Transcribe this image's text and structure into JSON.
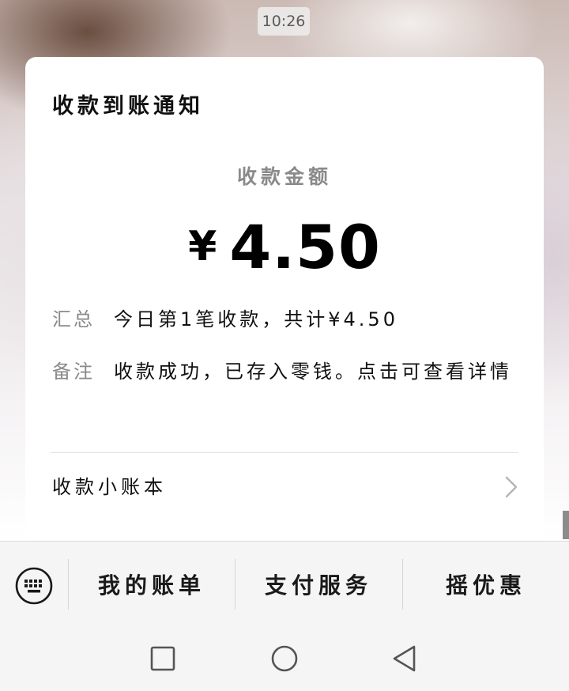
{
  "status": {
    "time": "10:26"
  },
  "card": {
    "title": "收款到账通知",
    "amount_label": "收款金额",
    "currency_symbol": "¥",
    "amount": "4.50",
    "summary": {
      "key": "汇总",
      "value": "今日第1笔收款，共计¥4.50"
    },
    "remark": {
      "key": "备注",
      "value": "收款成功，已存入零钱。点击可查看详情"
    },
    "ledger_link": "收款小账本"
  },
  "menu": {
    "items": [
      {
        "label": "我的账单"
      },
      {
        "label": "支付服务"
      },
      {
        "label": "摇优惠"
      }
    ]
  },
  "icons": {
    "keyboard": "keyboard-icon",
    "chevron": "chevron-right-icon",
    "nav_recent": "square-icon",
    "nav_home": "circle-icon",
    "nav_back": "triangle-back-icon"
  },
  "colors": {
    "card_bg": "#ffffff",
    "muted_text": "#8a8a8a",
    "bar_bg": "#f5f5f5"
  }
}
